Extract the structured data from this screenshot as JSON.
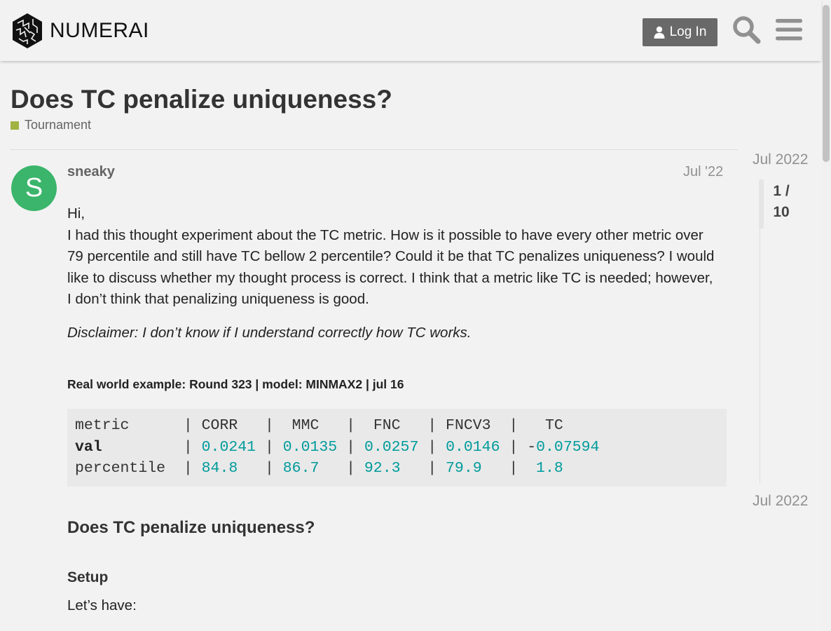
{
  "header": {
    "logo_text": "NUMERAI",
    "login_label": "Log In"
  },
  "topic": {
    "title": "Does TC penalize uniqueness?",
    "category": "Tournament",
    "category_color": "#a3b342"
  },
  "post": {
    "avatar_letter": "S",
    "avatar_color": "#3ab56b",
    "username": "sneaky",
    "date": "Jul '22",
    "greeting": "Hi,",
    "paragraph": "I had this thought experiment about the TC metric. How is it possible to have every other metric over 79 percentile and still have TC bellow 2 percentile? Could it be that TC penalizes uniqueness? I would like to discuss whether my thought process is correct. I think that a metric like TC is needed; however, I don’t think that penalizing uniqueness is good.",
    "disclaimer": "Disclaimer: I don’t know if I understand correctly how TC works.",
    "example_heading": "Real world example: Round 323 | model: MINMAX2 | jul 16",
    "code": {
      "header_row": [
        "metric",
        "CORR",
        "MMC",
        "FNC",
        "FNCV3",
        "TC"
      ],
      "val_label": "val",
      "val": [
        "0.0241",
        "0.0135",
        "0.0257",
        "0.0146",
        "-0.07594"
      ],
      "percentile_label": "percentile",
      "percentile": [
        "84.8",
        "86.7",
        "92.3",
        "79.9",
        "1.8"
      ]
    },
    "section_heading": "Does TC penalize uniqueness?",
    "setup_heading": "Setup",
    "lets_have": "Let’s have:"
  },
  "timeline": {
    "start_date": "Jul 2022",
    "position": "1 /",
    "total": "10",
    "end_date": "Jul 2022"
  }
}
